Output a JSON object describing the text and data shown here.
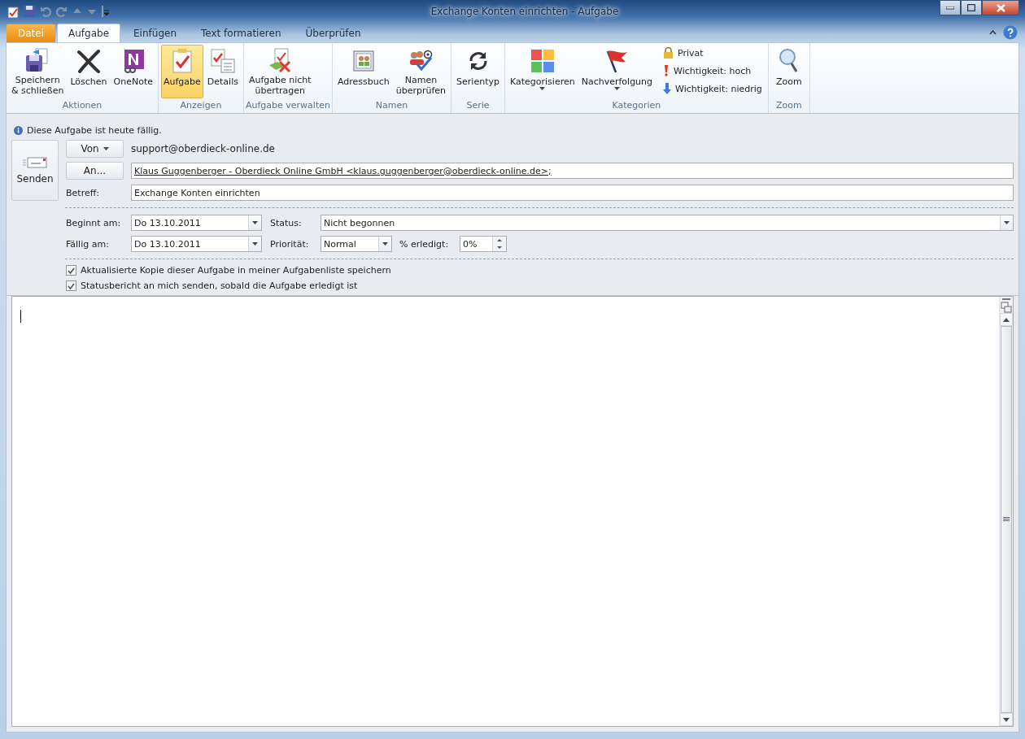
{
  "window": {
    "title": "Exchange Konten einrichten  -  Aufgabe"
  },
  "tabs": [
    {
      "label": "Datei",
      "kind": "file",
      "selected": false
    },
    {
      "label": "Aufgabe",
      "kind": "tab",
      "selected": true
    },
    {
      "label": "Einfügen",
      "kind": "tab",
      "selected": false
    },
    {
      "label": "Text formatieren",
      "kind": "tab",
      "selected": false
    },
    {
      "label": "Überprüfen",
      "kind": "tab",
      "selected": false
    }
  ],
  "ribbon": {
    "groups": [
      {
        "label": "Aktionen",
        "items": [
          {
            "label": "Speichern\n& schließen",
            "kind": "large",
            "selected": false,
            "dropdown": false
          },
          {
            "label": "Löschen",
            "kind": "large",
            "selected": false,
            "dropdown": false
          },
          {
            "label": "OneNote",
            "kind": "large",
            "selected": false,
            "dropdown": false
          }
        ]
      },
      {
        "label": "Anzeigen",
        "items": [
          {
            "label": "Aufgabe",
            "kind": "large",
            "selected": true,
            "dropdown": false
          },
          {
            "label": "Details",
            "kind": "large",
            "selected": false,
            "dropdown": false
          }
        ]
      },
      {
        "label": "Aufgabe verwalten",
        "items": [
          {
            "label": "Aufgabe nicht\nübertragen",
            "kind": "large",
            "selected": false,
            "dropdown": false
          }
        ]
      },
      {
        "label": "Namen",
        "items": [
          {
            "label": "Adressbuch",
            "kind": "large",
            "selected": false,
            "dropdown": false
          },
          {
            "label": "Namen\nüberprüfen",
            "kind": "large",
            "selected": false,
            "dropdown": false
          }
        ]
      },
      {
        "label": "Serie",
        "items": [
          {
            "label": "Serientyp",
            "kind": "large",
            "selected": false,
            "dropdown": false
          }
        ]
      },
      {
        "label": "Kategorien",
        "items": [
          {
            "label": "Kategorisieren",
            "kind": "large",
            "selected": false,
            "dropdown": true
          },
          {
            "label": "Nachverfolgung",
            "kind": "large",
            "selected": false,
            "dropdown": true
          },
          {
            "label": "Privat",
            "kind": "small",
            "selected": false
          },
          {
            "label": "Wichtigkeit: hoch",
            "kind": "small",
            "selected": false
          },
          {
            "label": "Wichtigkeit: niedrig",
            "kind": "small",
            "selected": false
          }
        ]
      },
      {
        "label": "Zoom",
        "items": [
          {
            "label": "Zoom",
            "kind": "large",
            "selected": false,
            "dropdown": false
          }
        ]
      }
    ]
  },
  "info_bar": {
    "text": "Diese Aufgabe ist heute fällig."
  },
  "send_button": {
    "label": "Senden"
  },
  "from": {
    "button": "Von",
    "value": "support@oberdieck-online.de"
  },
  "to": {
    "button": "An...",
    "value": "Klaus Guggenberger - Oberdieck Online GmbH <klaus.guggenberger@oberdieck-online.de>;"
  },
  "subject": {
    "label": "Betreff:",
    "value": "Exchange Konten einrichten"
  },
  "start": {
    "label": "Beginnt am:",
    "value": "Do 13.10.2011"
  },
  "due": {
    "label": "Fällig am:",
    "value": "Do 13.10.2011"
  },
  "status": {
    "label": "Status:",
    "value": "Nicht begonnen"
  },
  "priority": {
    "label": "Priorität:",
    "value": "Normal"
  },
  "percent": {
    "label": "% erledigt:",
    "value": "0%"
  },
  "checkboxes": [
    {
      "label": "Aktualisierte Kopie dieser Aufgabe in meiner Aufgabenliste speichern",
      "checked": true
    },
    {
      "label": "Statusbericht an mich senden, sobald die Aufgabe erledigt ist",
      "checked": true
    }
  ]
}
